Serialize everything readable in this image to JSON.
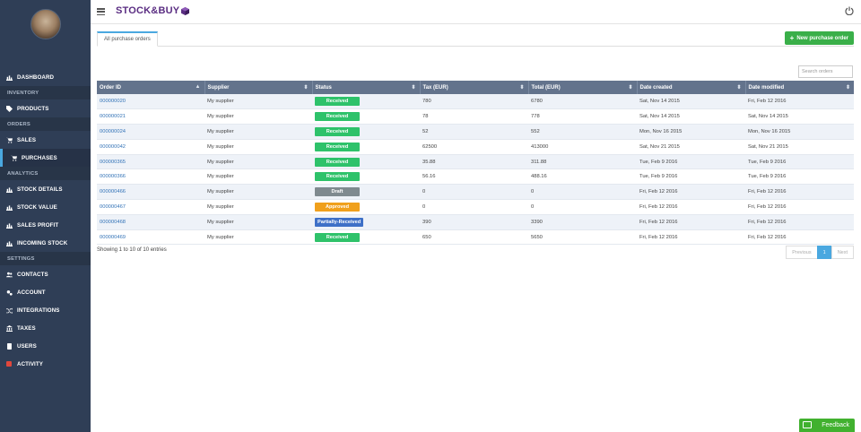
{
  "app": {
    "logo_text": "STOCK&BUY"
  },
  "sidebar": {
    "dashboard": "DASHBOARD",
    "section_inventory": "INVENTORY",
    "products": "PRODUCTS",
    "section_orders": "ORDERS",
    "sales": "SALES",
    "purchases": "PURCHASES",
    "section_analytics": "ANALYTICS",
    "stock_details": "STOCK DETAILS",
    "stock_value": "STOCK VALUE",
    "sales_profit": "SALES PROFIT",
    "incoming_stock": "INCOMING STOCK",
    "section_settings": "SETTINGS",
    "contacts": "CONTACTS",
    "account": "ACCOUNT",
    "integrations": "INTEGRATIONS",
    "taxes": "TAXES",
    "users": "USERS",
    "activity": "ACTIVITY"
  },
  "tabs": {
    "all_orders": "All purchase orders"
  },
  "toolbar": {
    "new_order": "New purchase order",
    "search_placeholder": "Search orders"
  },
  "table": {
    "headers": [
      "Order ID",
      "Supplier",
      "Status",
      "Tax (EUR)",
      "Total (EUR)",
      "Date created",
      "Date modified"
    ],
    "rows": [
      {
        "id": "000000020",
        "supplier": "My supplier",
        "status": "Received",
        "status_type": "received",
        "tax": "780",
        "total": "6780",
        "created": "Sat, Nov 14 2015",
        "modified": "Fri, Feb 12 2016"
      },
      {
        "id": "000000021",
        "supplier": "My supplier",
        "status": "Received",
        "status_type": "received",
        "tax": "78",
        "total": "778",
        "created": "Sat, Nov 14 2015",
        "modified": "Sat, Nov 14 2015"
      },
      {
        "id": "000000024",
        "supplier": "My supplier",
        "status": "Received",
        "status_type": "received",
        "tax": "52",
        "total": "552",
        "created": "Mon, Nov 16 2015",
        "modified": "Mon, Nov 16 2015"
      },
      {
        "id": "000000042",
        "supplier": "My supplier",
        "status": "Received",
        "status_type": "received",
        "tax": "62500",
        "total": "413000",
        "created": "Sat, Nov 21 2015",
        "modified": "Sat, Nov 21 2015"
      },
      {
        "id": "000000365",
        "supplier": "My supplier",
        "status": "Received",
        "status_type": "received",
        "tax": "35.88",
        "total": "311.88",
        "created": "Tue, Feb 9 2016",
        "modified": "Tue, Feb 9 2016"
      },
      {
        "id": "000000366",
        "supplier": "My supplier",
        "status": "Received",
        "status_type": "received",
        "tax": "56.16",
        "total": "488.16",
        "created": "Tue, Feb 9 2016",
        "modified": "Tue, Feb 9 2016"
      },
      {
        "id": "000000466",
        "supplier": "My supplier",
        "status": "Draft",
        "status_type": "draft",
        "tax": "0",
        "total": "0",
        "created": "Fri, Feb 12 2016",
        "modified": "Fri, Feb 12 2016"
      },
      {
        "id": "000000467",
        "supplier": "My supplier",
        "status": "Approved",
        "status_type": "approved",
        "tax": "0",
        "total": "0",
        "created": "Fri, Feb 12 2016",
        "modified": "Fri, Feb 12 2016"
      },
      {
        "id": "000000468",
        "supplier": "My supplier",
        "status": "Partially-Received",
        "status_type": "partial",
        "tax": "390",
        "total": "3390",
        "created": "Fri, Feb 12 2016",
        "modified": "Fri, Feb 12 2016"
      },
      {
        "id": "000000469",
        "supplier": "My supplier",
        "status": "Received",
        "status_type": "received",
        "tax": "650",
        "total": "5650",
        "created": "Fri, Feb 12 2016",
        "modified": "Fri, Feb 12 2016"
      }
    ]
  },
  "footer": {
    "showing": "Showing 1 to 10 of 10 entries"
  },
  "pager": {
    "previous": "Previous",
    "current": "1",
    "next": "Next"
  },
  "feedback": {
    "label": "Feedback"
  },
  "colors": {
    "sidebar": "#2f3e56",
    "header_row": "#63738c",
    "received": "#2ec26a",
    "draft": "#7f8a8f",
    "approved": "#f0a01c",
    "partial": "#3e70c7",
    "accent": "#4aa8e0",
    "brand": "#5a2d82"
  }
}
